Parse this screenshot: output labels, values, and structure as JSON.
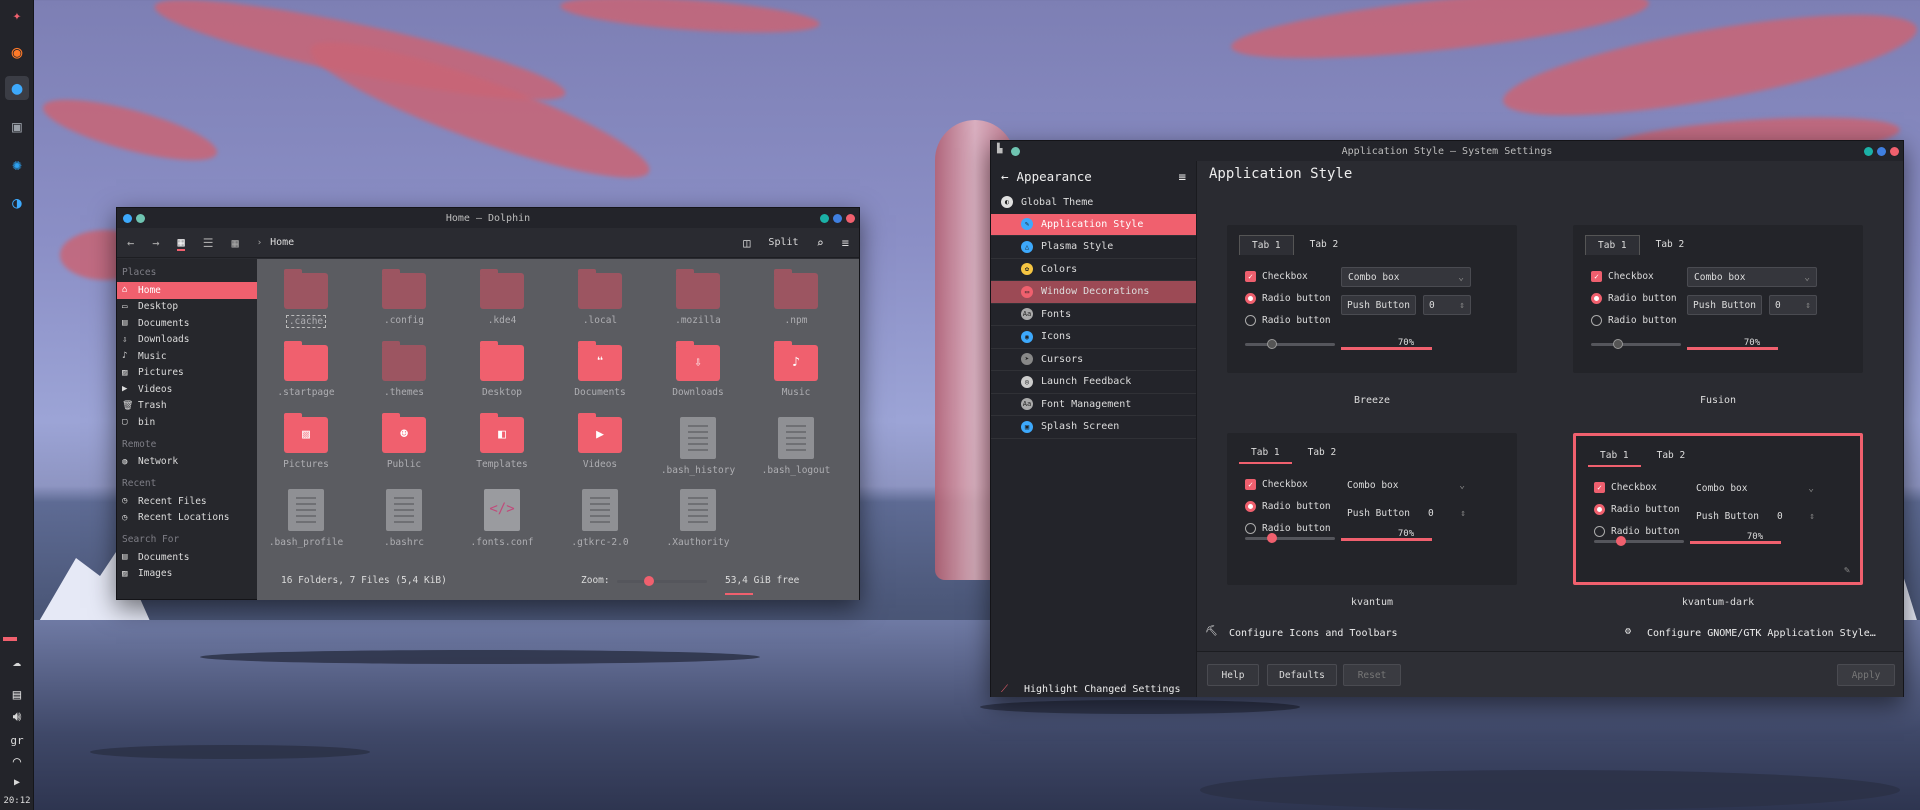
{
  "panel": {
    "clock": "20:12",
    "indicator": "gr"
  },
  "dolphin": {
    "title": "Home — Dolphin",
    "breadcrumb": "Home",
    "split_label": "Split",
    "sidebar": {
      "places_header": "Places",
      "places": [
        "Home",
        "Desktop",
        "Documents",
        "Downloads",
        "Music",
        "Pictures",
        "Videos",
        "Trash",
        "bin"
      ],
      "remote_header": "Remote",
      "remote": [
        "Network"
      ],
      "recent_header": "Recent",
      "recent": [
        "Recent Files",
        "Recent Locations"
      ],
      "search_header": "Search For",
      "search": [
        "Documents",
        "Images"
      ]
    },
    "files": [
      ".cache",
      ".config",
      ".kde4",
      ".local",
      ".mozilla",
      ".npm",
      ".startpage",
      ".themes",
      "Desktop",
      "Documents",
      "Downloads",
      "Music",
      "Pictures",
      "Public",
      "Templates",
      "Videos",
      ".bash_history",
      ".bash_logout",
      ".bash_profile",
      ".bashrc",
      ".fonts.conf",
      ".gtkrc-2.0",
      ".Xauthority"
    ],
    "status": "16 Folders, 7 Files (5,4 KiB)",
    "zoom_label": "Zoom:",
    "free_space": "53,4 GiB free",
    "zoom_level": 0.35
  },
  "settings": {
    "title": "Application Style — System Settings",
    "back_label": "Appearance",
    "page_title": "Application Style",
    "categories": [
      "Global Theme",
      "Application Style",
      "Plasma Style",
      "Colors",
      "Window Decorations",
      "Fonts",
      "Icons",
      "Cursors",
      "Launch Feedback",
      "Font Management",
      "Splash Screen"
    ],
    "highlight_label": "Highlight Changed Settings",
    "configure_icons": "Configure Icons and Toolbars",
    "configure_gtk": "Configure GNOME/GTK Application Style…",
    "buttons": {
      "help": "Help",
      "defaults": "Defaults",
      "reset": "Reset",
      "apply": "Apply"
    },
    "preview": {
      "tab1": "Tab 1",
      "tab2": "Tab 2",
      "checkbox": "Checkbox",
      "radio": "Radio button",
      "combo": "Combo box",
      "push": "Push Button",
      "spin": "0",
      "progress": "70%",
      "progress_value": 0.7
    },
    "styles": [
      "Breeze",
      "Fusion",
      "kvantum",
      "kvantum-dark"
    ],
    "selected_style": "kvantum-dark"
  },
  "colors": {
    "accent": "#f0606e",
    "window": "#2a2b31",
    "titlebar": "#23242a"
  }
}
